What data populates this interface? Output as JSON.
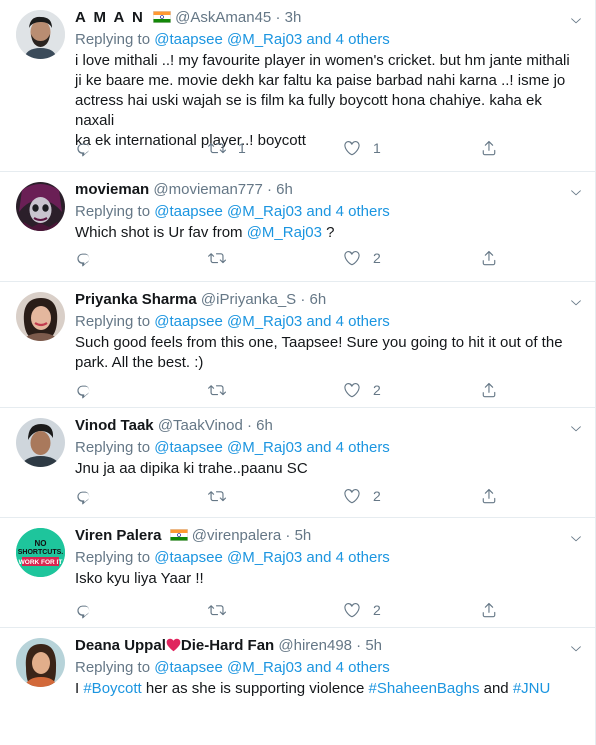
{
  "tweets": [
    {
      "name": "A M A N",
      "has_flag": true,
      "handle": "@AskAman45",
      "time": "3h",
      "replying_prefix": "Replying to",
      "replying_to": "@taapsee @M_Raj03 and 4 others",
      "text_lines": [
        "i love mithali ..! my favourite player in women's cricket. but hm jante mithali",
        "ji ke baare me. movie dekh kar faltu ka paise barbad nahi karna ..! isme jo",
        "actress hai uski wajah se is film ka fully boycott hona chahiye. kaha ek naxali",
        "ka ek international player..! boycott"
      ],
      "retweets": "1",
      "likes": "1",
      "avatar_icon": "bearded-man-avatar"
    },
    {
      "name": "movieman",
      "has_flag": false,
      "handle": "@movieman777",
      "time": "6h",
      "replying_prefix": "Replying to",
      "replying_to": "@taapsee @M_Raj03 and 4 others",
      "text_before": "Which shot is Ur fav from ",
      "text_link": "@M_Raj03",
      "text_after": " ?",
      "retweets": "",
      "likes": "2",
      "avatar_icon": "masked-face-avatar"
    },
    {
      "name": "Priyanka Sharma",
      "has_flag": false,
      "handle": "@iPriyanka_S",
      "time": "6h",
      "replying_prefix": "Replying to",
      "replying_to": "@taapsee @M_Raj03 and 4 others",
      "text_lines": [
        "Such good feels from this one, Taapsee! Sure you going to hit it out of the",
        "park. All the best. :)"
      ],
      "retweets": "",
      "likes": "2",
      "avatar_icon": "woman-avatar"
    },
    {
      "name": "Vinod Taak",
      "has_flag": false,
      "handle": "@TaakVinod",
      "time": "6h",
      "replying_prefix": "Replying to",
      "replying_to": "@taapsee @M_Raj03 and 4 others",
      "text_lines": [
        "Jnu ja aa dipika ki trahe..paanu SC"
      ],
      "retweets": "",
      "likes": "2",
      "avatar_icon": "man-avatar"
    },
    {
      "name": "Viren Palera",
      "has_flag": true,
      "handle": "@virenpalera",
      "time": "5h",
      "replying_prefix": "Replying to",
      "replying_to": "@taapsee @M_Raj03 and 4 others",
      "text_lines": [
        "Isko kyu liya Yaar !!"
      ],
      "retweets": "",
      "likes": "2",
      "avatar_icon": "no-shortcuts-logo-avatar",
      "avatar_text": [
        "NO",
        "SHORTCUTS.",
        "WORK FOR IT"
      ]
    },
    {
      "name_part1": "Deana Uppal",
      "name_part2": "Die-Hard Fan",
      "has_flag": false,
      "handle": "@hiren498",
      "time": "5h",
      "replying_prefix": "Replying to",
      "replying_to": "@taapsee @M_Raj03 and 4 others",
      "text_prefix": "I ",
      "text_link1": "#Boycott",
      "text_mid": " her as she is supporting violence ",
      "text_link2": "#ShaheenBaghs",
      "text_and": " and ",
      "text_link3": "#JNU",
      "avatar_icon": "woman-avatar"
    }
  ],
  "separator": "·",
  "colors": {
    "link": "#1b95e0",
    "muted": "#657786",
    "text": "#14171a",
    "heart": "#e0245e",
    "divider": "#e6ecf0"
  }
}
